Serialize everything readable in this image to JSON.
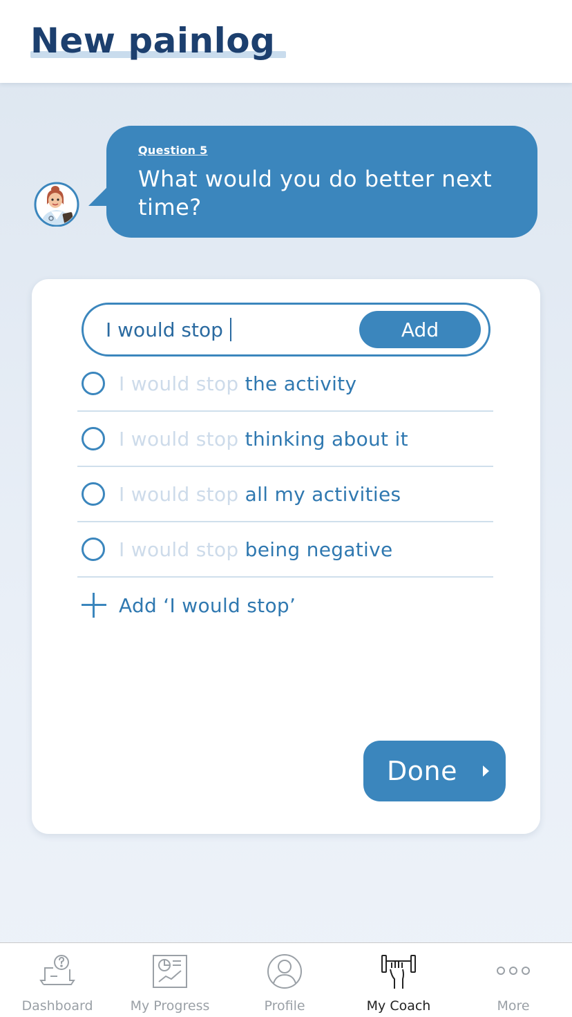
{
  "header": {
    "title": "New painlog"
  },
  "coach": {
    "question_label": "Question 5",
    "question_text": "What would you do better next time?"
  },
  "answer_input": {
    "value": "I would stop",
    "add_label": "Add"
  },
  "options": [
    {
      "prefix": "I would stop",
      "suffix": "the activity"
    },
    {
      "prefix": "I would stop",
      "suffix": "thinking about it"
    },
    {
      "prefix": "I would stop",
      "suffix": "all my activities"
    },
    {
      "prefix": "I would stop",
      "suffix": "being negative"
    }
  ],
  "add_option_label": "Add ‘I would stop’",
  "done_label": "Done",
  "tabbar": {
    "tabs": [
      {
        "label": "Dashboard",
        "icon": "dashboard-question-icon",
        "active": false
      },
      {
        "label": "My Progress",
        "icon": "progress-chart-icon",
        "active": false
      },
      {
        "label": "Profile",
        "icon": "profile-person-icon",
        "active": false
      },
      {
        "label": "My Coach",
        "icon": "coach-muscle-icon",
        "active": true
      },
      {
        "label": "More",
        "icon": "more-dots-icon",
        "active": false
      }
    ]
  },
  "colors": {
    "primary": "#3b86bd",
    "title": "#1c3f6e",
    "option_text": "#2f78b0",
    "option_prefix": "#cddbea"
  }
}
